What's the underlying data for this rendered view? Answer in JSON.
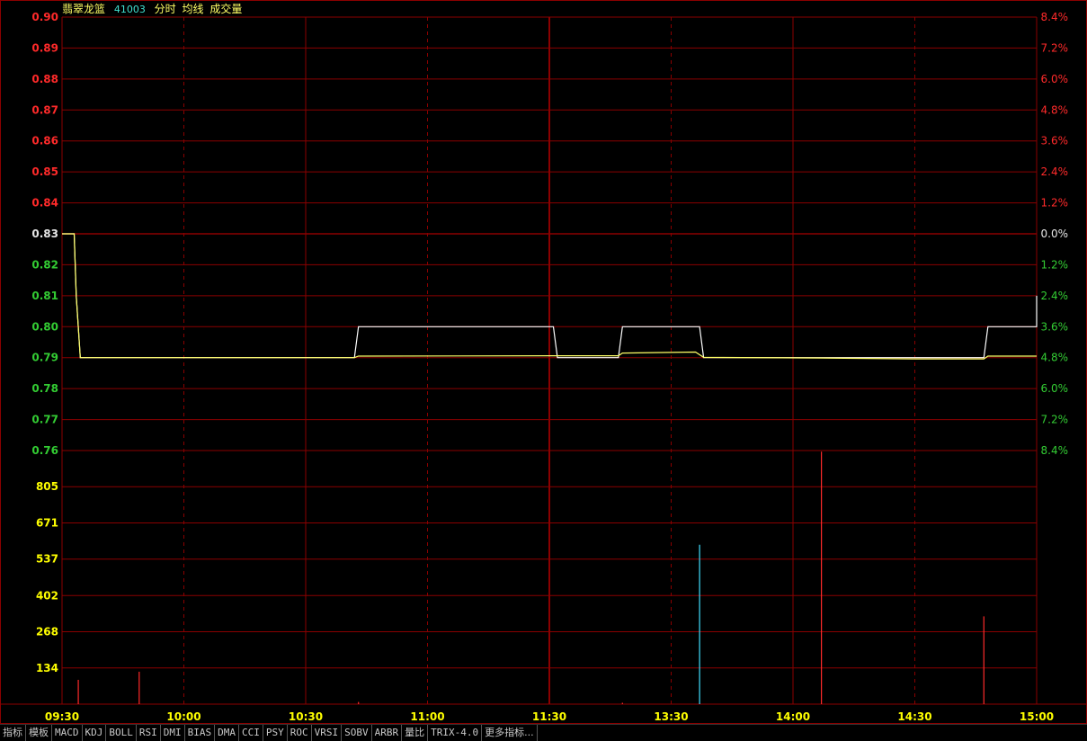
{
  "header": {
    "stock_name": "翡翠龙篮",
    "code": "41003",
    "labels": [
      "分时",
      "均线",
      "成交量"
    ]
  },
  "colors": {
    "background": "#000000",
    "grid": "#8b0000",
    "up": "#ff2a2a",
    "down": "#33cc33",
    "flat": "#e6e6e6",
    "price_line": "#ffffff",
    "avg_line": "#ffff66",
    "volume_label": "#ffff00",
    "time_label": "#ffff00",
    "name": "#ffff66",
    "code": "#40e0d0",
    "header_labels": "#ffff66"
  },
  "chart_data": {
    "type": "line",
    "title": "",
    "prev_close": 0.83,
    "price_axis": {
      "ylim": [
        0.76,
        0.9
      ],
      "ticks": [
        "0.90",
        "0.89",
        "0.88",
        "0.87",
        "0.86",
        "0.85",
        "0.84",
        "0.83",
        "0.82",
        "0.81",
        "0.80",
        "0.79",
        "0.78",
        "0.77",
        "0.76"
      ]
    },
    "percent_axis": {
      "ticks": [
        "8.4%",
        "7.2%",
        "6.0%",
        "4.8%",
        "3.6%",
        "2.4%",
        "1.2%",
        "0.0%",
        "1.2%",
        "2.4%",
        "3.6%",
        "4.8%",
        "6.0%",
        "7.2%",
        "8.4%"
      ]
    },
    "volume_axis": {
      "ylim": [
        0,
        939
      ],
      "ticks": [
        "805",
        "671",
        "537",
        "402",
        "268",
        "134"
      ]
    },
    "time_axis": {
      "total_minutes": 240,
      "ticks": [
        {
          "label": "09:30",
          "minute": 0
        },
        {
          "label": "10:00",
          "minute": 30
        },
        {
          "label": "10:30",
          "minute": 60
        },
        {
          "label": "11:00",
          "minute": 90
        },
        {
          "label": "11:30",
          "minute": 120
        },
        {
          "label": "13:30",
          "minute": 150
        },
        {
          "label": "14:00",
          "minute": 180
        },
        {
          "label": "14:30",
          "minute": 210
        },
        {
          "label": "15:00",
          "minute": 240
        }
      ]
    },
    "series": [
      {
        "key": "price",
        "points": [
          [
            0,
            0.83
          ],
          [
            3,
            0.83
          ],
          [
            3.5,
            0.81
          ],
          [
            4.5,
            0.79
          ],
          [
            72,
            0.79
          ],
          [
            73,
            0.8
          ],
          [
            121,
            0.8
          ],
          [
            122,
            0.79
          ],
          [
            137,
            0.79
          ],
          [
            138,
            0.8
          ],
          [
            157,
            0.8
          ],
          [
            158,
            0.79
          ],
          [
            227,
            0.79
          ],
          [
            228,
            0.8
          ],
          [
            240,
            0.8
          ],
          [
            240,
            0.81
          ]
        ]
      },
      {
        "key": "average",
        "points": [
          [
            0,
            0.83
          ],
          [
            3,
            0.83
          ],
          [
            3.5,
            0.81
          ],
          [
            4.5,
            0.79
          ],
          [
            72,
            0.79
          ],
          [
            73,
            0.7905
          ],
          [
            121,
            0.7906
          ],
          [
            122,
            0.7906
          ],
          [
            137,
            0.7906
          ],
          [
            138,
            0.7915
          ],
          [
            156,
            0.7918
          ],
          [
            158,
            0.7901
          ],
          [
            187,
            0.7899
          ],
          [
            210,
            0.7896
          ],
          [
            227,
            0.7896
          ],
          [
            228,
            0.7905
          ],
          [
            240,
            0.7905
          ]
        ]
      }
    ],
    "volume": [
      {
        "minute": 4,
        "value": 90,
        "color": "up"
      },
      {
        "minute": 19,
        "value": 120,
        "color": "up"
      },
      {
        "minute": 73,
        "value": 8,
        "color": "up"
      },
      {
        "minute": 138,
        "value": 5,
        "color": "up"
      },
      {
        "minute": 157,
        "value": 590,
        "color": "cyan"
      },
      {
        "minute": 187,
        "value": 935,
        "color": "up"
      },
      {
        "minute": 227,
        "value": 325,
        "color": "up"
      }
    ]
  },
  "toolbar": {
    "tabs": [
      "指标",
      "模板",
      "MACD",
      "KDJ",
      "BOLL",
      "RSI",
      "DMI",
      "BIAS",
      "DMA",
      "CCI",
      "PSY",
      "ROC",
      "VRSI",
      "SOBV",
      "ARBR",
      "量比",
      "TRIX-4.0",
      "更多指标..."
    ]
  }
}
